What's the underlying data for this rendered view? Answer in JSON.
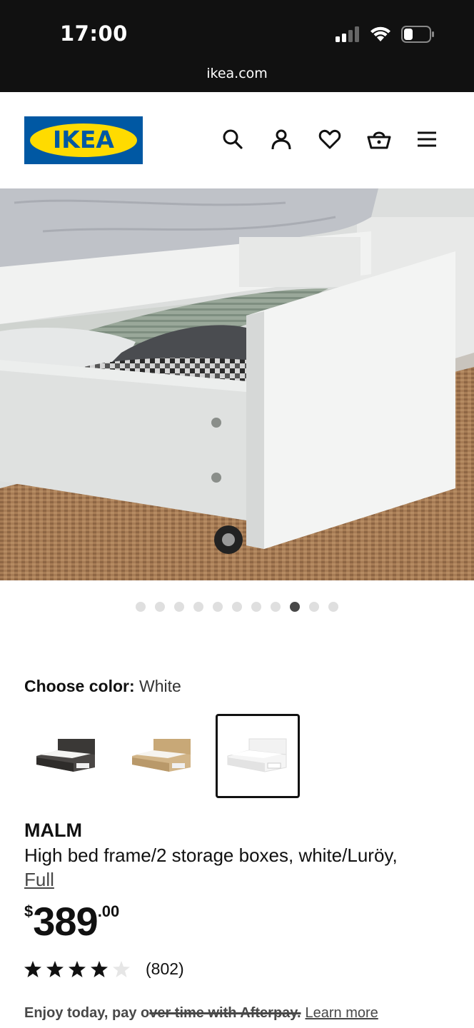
{
  "status_bar": {
    "time": "17:00",
    "url": "ikea.com"
  },
  "header": {
    "logo_text": "IKEA",
    "icons": [
      "search-icon",
      "account-icon",
      "heart-icon",
      "basket-icon",
      "menu-icon"
    ]
  },
  "gallery": {
    "total_images": 11,
    "active_index": 8
  },
  "color_chooser": {
    "label": "Choose color:",
    "selected_value": "White",
    "options": [
      "black-brown",
      "oak veneer",
      "white"
    ],
    "selected_index": 2
  },
  "product": {
    "name": "MALM",
    "description": "High bed frame/2 storage boxes, white/Luröy,",
    "size_link": "Full",
    "price": {
      "currency": "$",
      "integer": "389",
      "decimal": ".00"
    },
    "rating": {
      "stars": 4,
      "max": 5,
      "reviews": "(802)"
    }
  },
  "afterpay": {
    "lead": "Enjoy today, pay o",
    "struck": "ver time with Afterpay.",
    "link": "Learn more"
  },
  "colors": {
    "ikea_blue": "#0058a3",
    "ikea_yellow": "#ffdb00",
    "status_bar": "#111111"
  }
}
